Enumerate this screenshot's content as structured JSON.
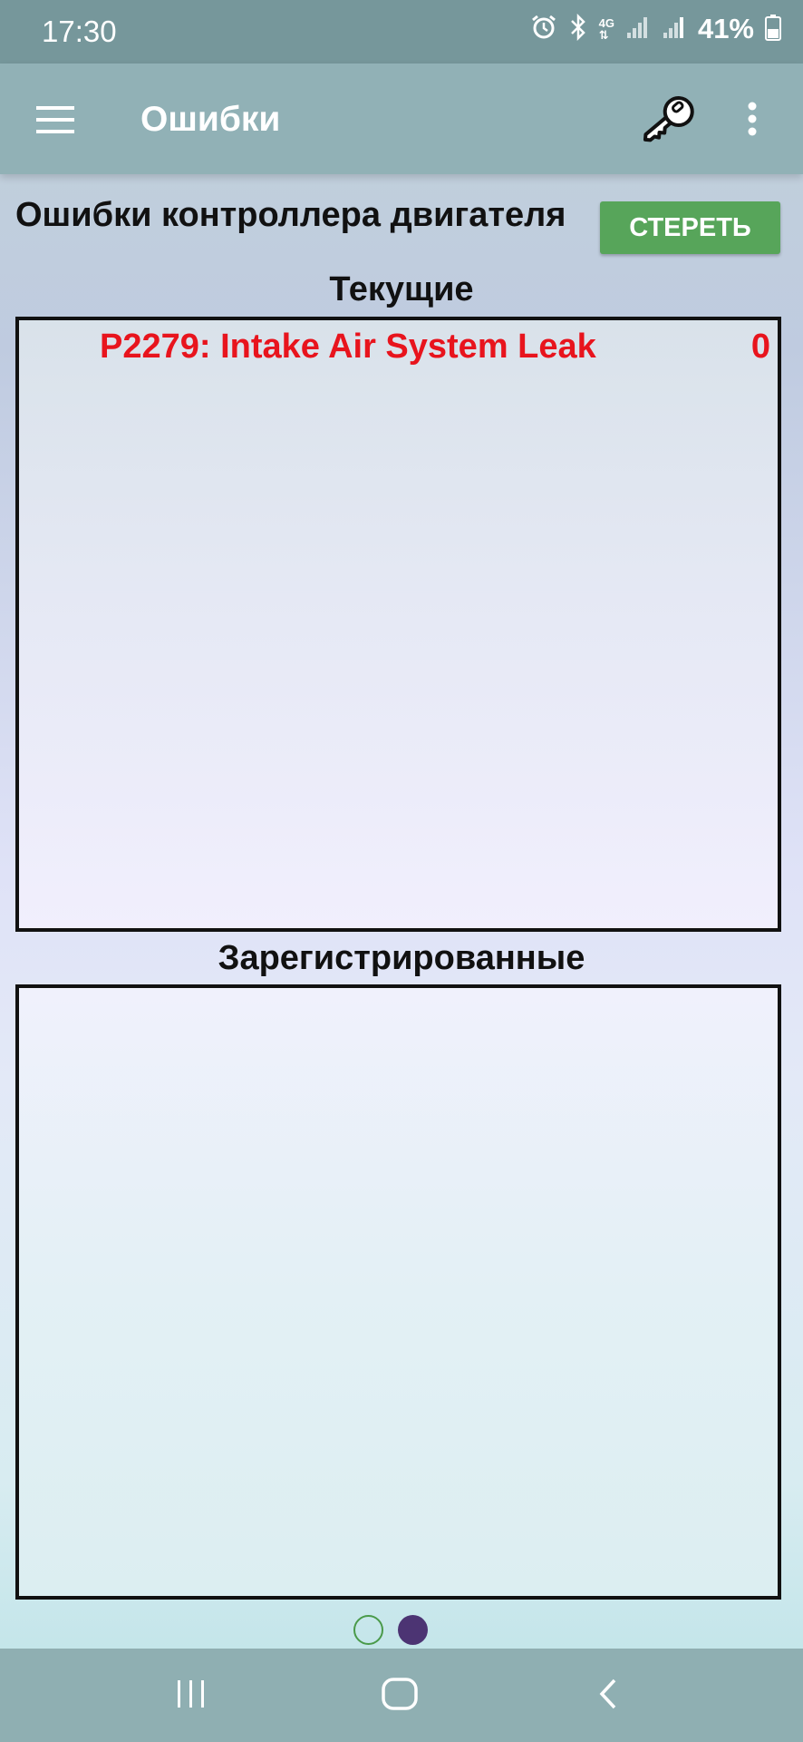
{
  "status_bar": {
    "time": "17:30",
    "network": "4G",
    "battery": "41%"
  },
  "app_bar": {
    "title": "Ошибки"
  },
  "ecu": {
    "heading": "Ошибки контроллера двигателя",
    "clear_label": "СТЕРЕТЬ"
  },
  "current": {
    "title": "Текущие",
    "items": [
      {
        "code": "P2279: Intake Air System Leak",
        "count": "0"
      }
    ]
  },
  "registered": {
    "title": "Зарегистрированные",
    "items": []
  },
  "pager": {
    "pages": 2,
    "active_index": 1
  },
  "colors": {
    "status_bar": "#76979b",
    "app_bar": "#91b1b6",
    "button": "#57a55a",
    "error_text": "#e8141d",
    "active_dot": "#4c3473"
  }
}
